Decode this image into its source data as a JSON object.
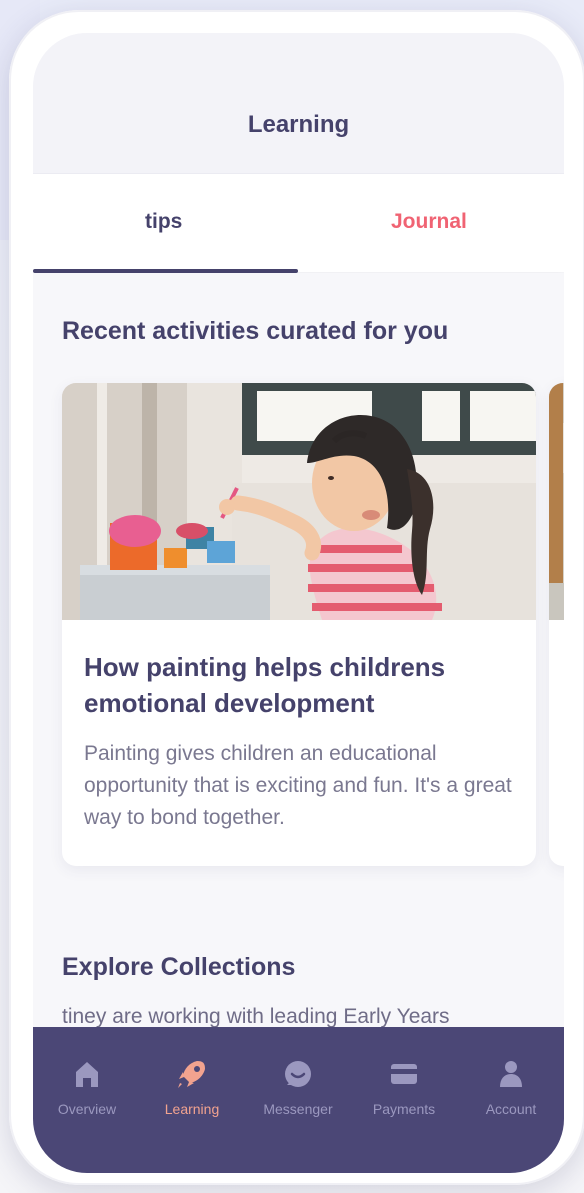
{
  "header": {
    "title": "Learning"
  },
  "tabs": [
    {
      "label": "tips",
      "active": true
    },
    {
      "label": "Journal",
      "active": false
    }
  ],
  "recent": {
    "title": "Recent activities curated for you",
    "card": {
      "title": "How painting helps childrens emotional development",
      "description": "Painting gives children an educational opportunity that is exciting and fun. It's a great way to bond together."
    }
  },
  "explore": {
    "title": "Explore Collections",
    "description": "tiney are working with leading Early Years"
  },
  "bottom_nav": {
    "items": [
      {
        "label": "Overview",
        "icon": "home-icon"
      },
      {
        "label": "Learning",
        "icon": "rocket-icon"
      },
      {
        "label": "Messenger",
        "icon": "chat-icon"
      },
      {
        "label": "Payments",
        "icon": "card-icon"
      },
      {
        "label": "Account",
        "icon": "user-icon"
      }
    ],
    "active": "Learning"
  },
  "colors": {
    "primary": "#45426b",
    "accent": "#f06373",
    "active_nav": "#f2a38f",
    "nav_background": "#4b4776",
    "nav_inactive": "#9b98bf"
  }
}
